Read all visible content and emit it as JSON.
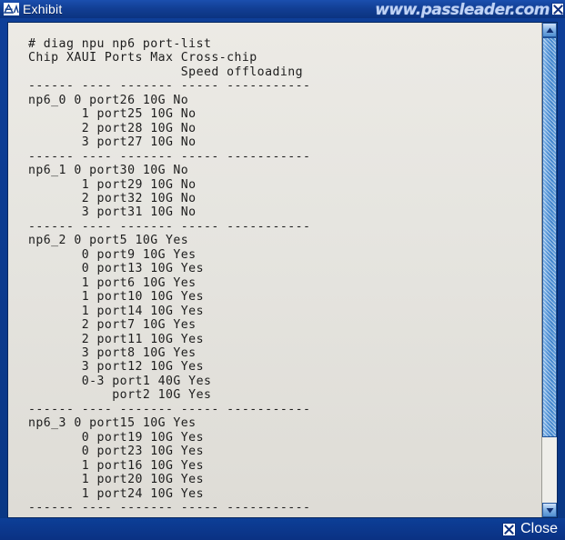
{
  "window": {
    "title": "Exhibit",
    "icon": "exhibit-icon",
    "watermark": "www.passleader.com"
  },
  "titlebar": {
    "close_icon": "close-x-icon"
  },
  "bottombar": {
    "close_label": "Close",
    "close_icon": "close-x-icon"
  },
  "scrollbar": {
    "up_icon": "triangle-up-icon",
    "down_icon": "triangle-down-icon",
    "thumb_name": "scrollbar-thumb"
  },
  "terminal": {
    "prompt_line": "# diag npu np6 port-list",
    "header_line_1": "Chip XAUI Ports Max Cross-chip",
    "header_line_2": "                    Speed offloading",
    "separator": "------ ---- ------- ----- -----------",
    "columns": [
      "Chip",
      "XAUI",
      "Ports",
      "Max Speed",
      "Cross-chip offloading"
    ],
    "groups": [
      {
        "chip": "np6_0",
        "rows": [
          {
            "xaui": "0",
            "port": "port26",
            "speed": "10G",
            "offloading": "No"
          },
          {
            "xaui": "1",
            "port": "port25",
            "speed": "10G",
            "offloading": "No"
          },
          {
            "xaui": "2",
            "port": "port28",
            "speed": "10G",
            "offloading": "No"
          },
          {
            "xaui": "3",
            "port": "port27",
            "speed": "10G",
            "offloading": "No"
          }
        ]
      },
      {
        "chip": "np6_1",
        "rows": [
          {
            "xaui": "0",
            "port": "port30",
            "speed": "10G",
            "offloading": "No"
          },
          {
            "xaui": "1",
            "port": "port29",
            "speed": "10G",
            "offloading": "No"
          },
          {
            "xaui": "2",
            "port": "port32",
            "speed": "10G",
            "offloading": "No"
          },
          {
            "xaui": "3",
            "port": "port31",
            "speed": "10G",
            "offloading": "No"
          }
        ]
      },
      {
        "chip": "np6_2",
        "rows": [
          {
            "xaui": "0",
            "port": "port5",
            "speed": "10G",
            "offloading": "Yes"
          },
          {
            "xaui": "0",
            "port": "port9",
            "speed": "10G",
            "offloading": "Yes"
          },
          {
            "xaui": "0",
            "port": "port13",
            "speed": "10G",
            "offloading": "Yes"
          },
          {
            "xaui": "1",
            "port": "port6",
            "speed": "10G",
            "offloading": "Yes"
          },
          {
            "xaui": "1",
            "port": "port10",
            "speed": "10G",
            "offloading": "Yes"
          },
          {
            "xaui": "1",
            "port": "port14",
            "speed": "10G",
            "offloading": "Yes"
          },
          {
            "xaui": "2",
            "port": "port7",
            "speed": "10G",
            "offloading": "Yes"
          },
          {
            "xaui": "2",
            "port": "port11",
            "speed": "10G",
            "offloading": "Yes"
          },
          {
            "xaui": "3",
            "port": "port8",
            "speed": "10G",
            "offloading": "Yes"
          },
          {
            "xaui": "3",
            "port": "port12",
            "speed": "10G",
            "offloading": "Yes"
          },
          {
            "xaui": "0-3",
            "port": "port1",
            "speed": "40G",
            "offloading": "Yes"
          },
          {
            "xaui": "",
            "port": "port2",
            "speed": "10G",
            "offloading": "Yes"
          }
        ]
      },
      {
        "chip": "np6_3",
        "rows": [
          {
            "xaui": "0",
            "port": "port15",
            "speed": "10G",
            "offloading": "Yes"
          },
          {
            "xaui": "0",
            "port": "port19",
            "speed": "10G",
            "offloading": "Yes"
          },
          {
            "xaui": "0",
            "port": "port23",
            "speed": "10G",
            "offloading": "Yes"
          },
          {
            "xaui": "1",
            "port": "port16",
            "speed": "10G",
            "offloading": "Yes"
          },
          {
            "xaui": "1",
            "port": "port20",
            "speed": "10G",
            "offloading": "Yes"
          },
          {
            "xaui": "1",
            "port": "port24",
            "speed": "10G",
            "offloading": "Yes"
          }
        ]
      }
    ]
  },
  "colors": {
    "title_bar": "#123f95",
    "console_bg": "#e7e5e0",
    "console_text": "#1d1d1d",
    "scroll_thumb": "#5796d8"
  }
}
